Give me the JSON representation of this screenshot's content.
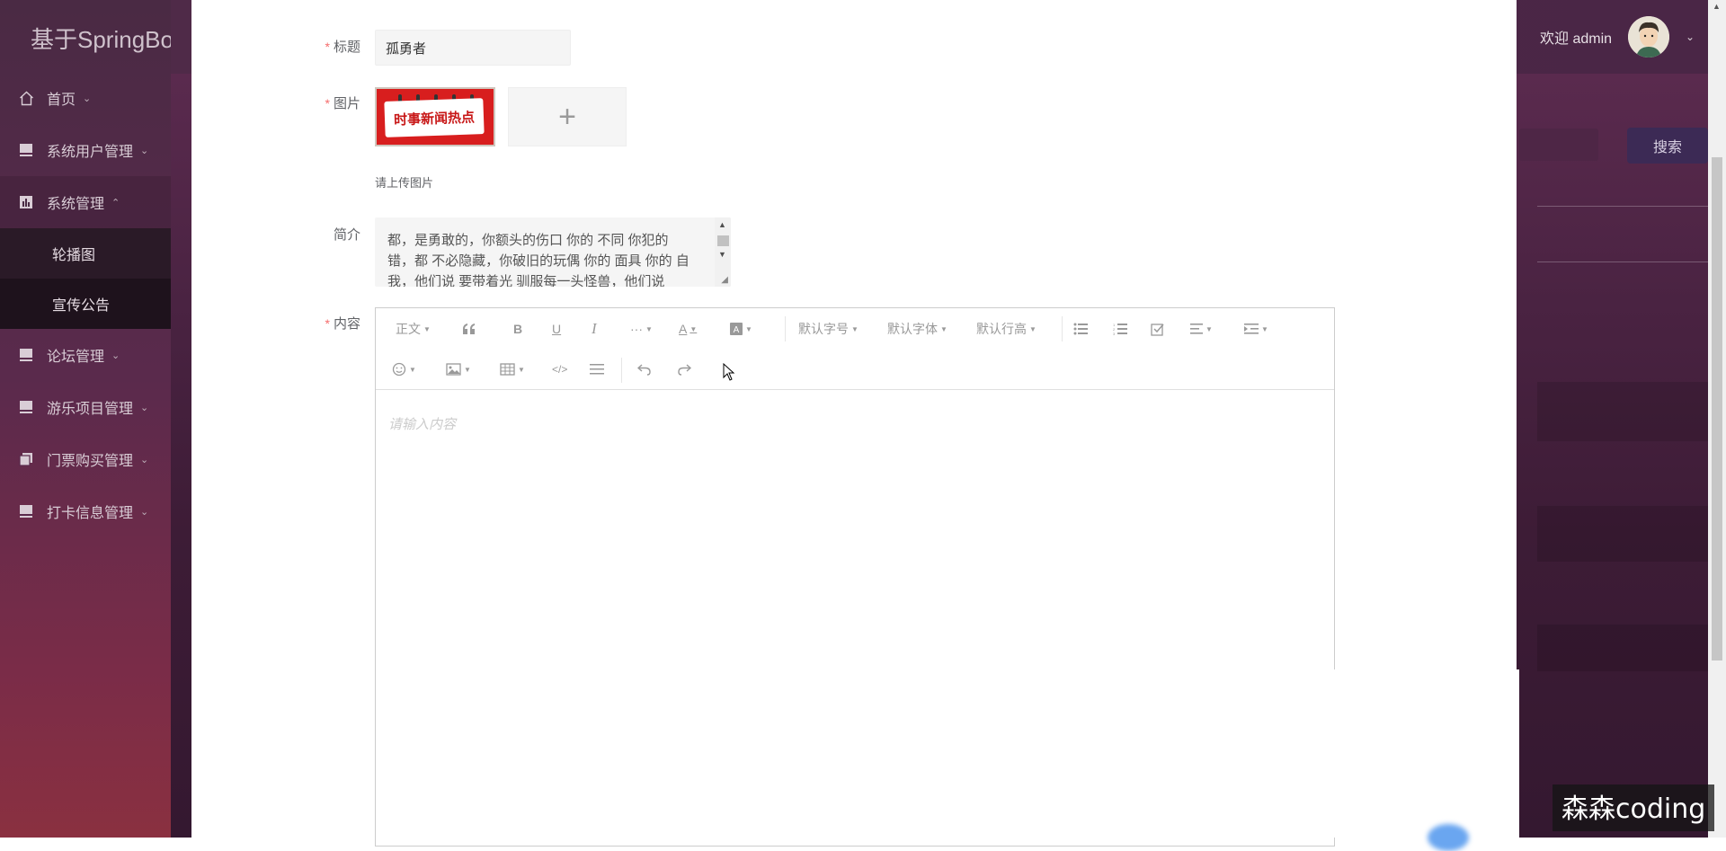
{
  "sidebar": {
    "logo": "基于SpringBo",
    "items": [
      {
        "label": "首页",
        "icon": "home-icon",
        "arrow": "⌄"
      },
      {
        "label": "系统用户管理",
        "icon": "book-icon",
        "arrow": "⌄"
      },
      {
        "label": "系统管理",
        "icon": "chart-icon",
        "arrow": "⌃"
      },
      {
        "label": "论坛管理",
        "icon": "book-icon",
        "arrow": "⌄"
      },
      {
        "label": "游乐项目管理",
        "icon": "book-icon",
        "arrow": "⌄"
      },
      {
        "label": "门票购买管理",
        "icon": "copy-icon",
        "arrow": "⌄"
      },
      {
        "label": "打卡信息管理",
        "icon": "book-icon",
        "arrow": "⌄"
      }
    ],
    "subitems": [
      {
        "label": "轮播图"
      },
      {
        "label": "宣传公告"
      }
    ]
  },
  "header": {
    "welcome": "欢迎 admin",
    "caret": "⌄"
  },
  "search": {
    "button": "搜索"
  },
  "form": {
    "title_label": "标题",
    "title_value": "孤勇者",
    "image_label": "图片",
    "image_text": "时事新闻热点",
    "upload_plus": "+",
    "upload_tip": "请上传图片",
    "intro_label": "简介",
    "intro_text": "都，是勇敢的，你额头的伤口 你的 不同 你犯的 错，都 不必隐藏，你破旧的玩偶 你的 面具 你的 自我，他们说 要带着光 驯服每一头怪兽，他们说",
    "content_label": "内容",
    "required_mark": "*"
  },
  "editor": {
    "toolbar": {
      "paragraph": "正文",
      "font_size": "默认字号",
      "font_family": "默认字体",
      "line_height": "默认行高"
    },
    "placeholder": "请输入内容"
  },
  "watermark": "森森coding",
  "colors": {
    "required": "#f56c6c",
    "sidebar": "#5a2a4c",
    "search_button": "#3c2a55"
  }
}
